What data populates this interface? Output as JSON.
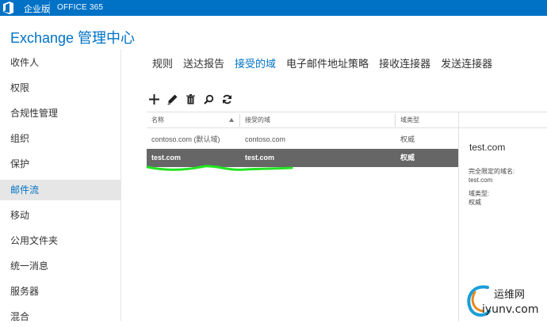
{
  "topbar": {
    "brand": "企业版",
    "product": "OFFICE 365"
  },
  "title": "Exchange 管理中心",
  "sidebar": {
    "items": [
      {
        "label": "收件人",
        "active": false
      },
      {
        "label": "权限",
        "active": false
      },
      {
        "label": "合规性管理",
        "active": false
      },
      {
        "label": "组织",
        "active": false
      },
      {
        "label": "保护",
        "active": false
      },
      {
        "label": "邮件流",
        "active": true
      },
      {
        "label": "移动",
        "active": false
      },
      {
        "label": "公用文件夹",
        "active": false
      },
      {
        "label": "统一消息",
        "active": false
      },
      {
        "label": "服务器",
        "active": false
      },
      {
        "label": "混合",
        "active": false
      }
    ]
  },
  "tabs": [
    {
      "label": "规则",
      "active": false
    },
    {
      "label": "送达报告",
      "active": false
    },
    {
      "label": "接受的域",
      "active": true
    },
    {
      "label": "电子邮件地址策略",
      "active": false
    },
    {
      "label": "接收连接器",
      "active": false
    },
    {
      "label": "发送连接器",
      "active": false
    }
  ],
  "toolbar": [
    "add-icon",
    "edit-icon",
    "delete-icon",
    "search-icon",
    "refresh-icon"
  ],
  "table": {
    "columns": [
      "名称",
      "接受的域",
      "域类型"
    ],
    "rows": [
      {
        "name": "contoso.com (默认域)",
        "domain": "contoso.com",
        "type": "权威",
        "selected": false
      },
      {
        "name": "test.com",
        "domain": "test.com",
        "type": "权威",
        "selected": true
      }
    ]
  },
  "details": {
    "title": "test.com",
    "fqdn_label": "完全限定的域名:",
    "fqdn_value": "test.com",
    "type_label": "域类型:",
    "type_value": "权威"
  },
  "watermark": {
    "line1": "运维网",
    "line2": "iyunv.com"
  },
  "colors": {
    "accent": "#0072c6",
    "selected_row": "#666666",
    "annotation": "#22e522"
  }
}
